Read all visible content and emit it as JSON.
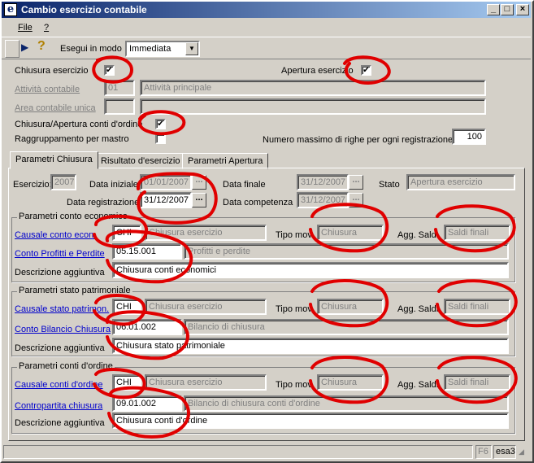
{
  "window": {
    "title": "Cambio esercizio contabile",
    "icon_letter": "e",
    "controls": [
      "_",
      "□",
      "×"
    ]
  },
  "menu": {
    "file": "File",
    "help": "?"
  },
  "toolbar": {
    "run_label": "Esegui in modo",
    "run_mode": "Immediata"
  },
  "header": {
    "chiusura_label": "Chiusura esercizio",
    "chiusura_checked": "✔",
    "apertura_label": "Apertura esercizio",
    "apertura_checked": "✔",
    "attivita_label": "Attività contabile",
    "attivita_code": "01",
    "attivita_desc": "Attività principale",
    "area_label": "Area contabile unica",
    "conti_ordine_label": "Chiusura/Apertura conti d'ordine",
    "conti_ordine_checked": "✔",
    "raggruppamento_label": "Raggruppamento per mastro",
    "max_righe_label": "Numero massimo di righe per ogni registrazione",
    "max_righe_value": "100"
  },
  "tabs": [
    "Parametri Chiusura",
    "Risultato d'esercizio",
    "Parametri Apertura"
  ],
  "main": {
    "esercizio_label": "Esercizio:",
    "esercizio_value": "2007",
    "data_iniziale_label": "Data iniziale",
    "data_iniziale_value": "01/01/2007",
    "data_finale_label": "Data finale",
    "data_finale_value": "31/12/2007",
    "stato_label": "Stato",
    "stato_value": "Apertura esercizio",
    "data_registrazione_label": "Data registrazione",
    "data_registrazione_value": "31/12/2007",
    "data_competenza_label": "Data competenza",
    "data_competenza_value": "31/12/2007",
    "dots": "..."
  },
  "groups": [
    {
      "title": "Parametri conto economico",
      "causale_label": "Causale conto econ.",
      "causale_code": "CHI",
      "causale_desc": "Chiusura esercizio",
      "tipo_mov_label": "Tipo mov.",
      "tipo_mov_value": "Chiusura",
      "agg_saldi_label": "Agg. Saldi",
      "agg_saldi_value": "Saldi finali",
      "conto_label": "Conto Profitti e Perdite",
      "conto_code": "05.15.001",
      "conto_desc": "Profitti e perdite",
      "descr_label": "Descrizione aggiuntiva",
      "descr_value": "Chiusura conti economici"
    },
    {
      "title": "Parametri stato patrimoniale",
      "causale_label": "Causale stato patrimon.",
      "causale_code": "CHI",
      "causale_desc": "Chiusura esercizio",
      "tipo_mov_label": "Tipo mov.",
      "tipo_mov_value": "Chiusura",
      "agg_saldi_label": "Agg. Saldi",
      "agg_saldi_value": "Saldi finali",
      "conto_label": "Conto Bilancio Chiusura",
      "conto_code": "06.01.002",
      "conto_desc": "Bilancio di chiusura",
      "descr_label": "Descrizione aggiuntiva",
      "descr_value": "Chiusura stato patrimoniale"
    },
    {
      "title": "Parametri conti d'ordine",
      "causale_label": "Causale conti d'ordine",
      "causale_code": "CHI",
      "causale_desc": "Chiusura esercizio",
      "tipo_mov_label": "Tipo mov.",
      "tipo_mov_value": "Chiusura",
      "agg_saldi_label": "Agg. Saldi",
      "agg_saldi_value": "Saldi finali",
      "conto_label": "Contropartita chiusura",
      "conto_code": "09.01.002",
      "conto_desc": "Bilancio di chiusura conti d'ordine",
      "descr_label": "Descrizione aggiuntiva",
      "descr_value": "Chiusura conti d'ordine"
    }
  ],
  "statusbar": {
    "key": "F6",
    "user": "esa3"
  },
  "colors": {
    "annotation": "#e00000",
    "title_start": "#0a246a",
    "link": "#0000cc"
  }
}
